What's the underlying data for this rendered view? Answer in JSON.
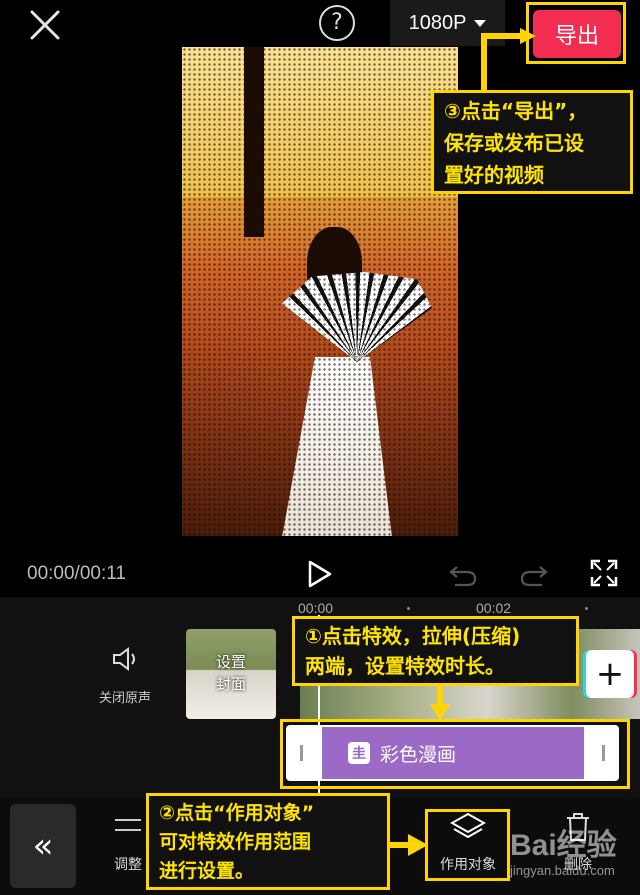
{
  "header": {
    "resolution": "1080P",
    "export_label": "导出"
  },
  "player": {
    "time": "00:00/00:11"
  },
  "timeline": {
    "ticks": [
      "00:00",
      "00:02"
    ],
    "mute_label": "关闭原声",
    "cover_label_line1": "设置",
    "cover_label_line2": "封面",
    "effect_name": "彩色漫画",
    "effect_icon_glyph": "圭"
  },
  "toolbar": {
    "adjust_label": "调整",
    "apply_target_label": "作用对象",
    "delete_label": "删除"
  },
  "annotations": {
    "step1_line1": "①点击特效，拉伸(压缩)",
    "step1_line2": "两端，设置特效时长。",
    "step2_line1": "②点击“作用对象”",
    "step2_line2": "可对特效作用范围",
    "step2_line3": "进行设置。",
    "step3_line1": "③点击“导出”，",
    "step3_line2": "保存或发布已设",
    "step3_line3": "置好的视频"
  },
  "watermark": {
    "brand": "Bai经验",
    "url": "jingyan.baidu.com"
  },
  "colors": {
    "accent_export": "#f32c52",
    "callout_border": "#ffd400",
    "effect_purple": "#9a6ac6"
  }
}
